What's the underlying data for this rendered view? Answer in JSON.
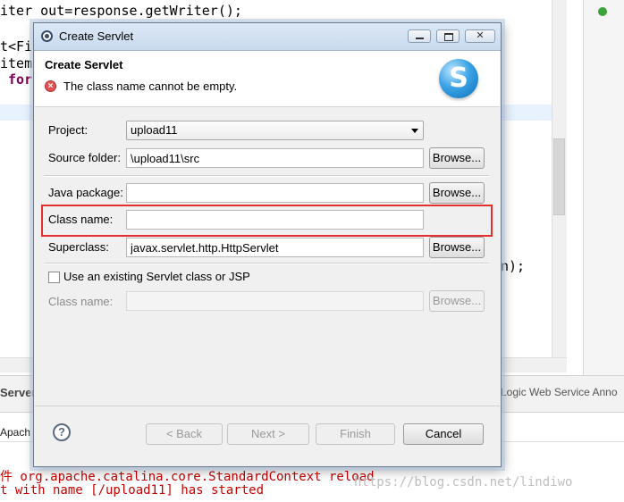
{
  "background": {
    "code_lines": [
      {
        "text": "iter out=response.getWriter();"
      },
      {
        "text": "t<Fil"
      },
      {
        "text": "items"
      },
      {
        "text": " for"
      },
      {
        "text": "n);"
      }
    ],
    "panel_tabs": {
      "left": "Server",
      "right": "Logic Web Service Anno"
    },
    "apach_label": "Apach",
    "console_lines": [
      "件 org.apache.catalina.core.StandardContext reload",
      "t with name [/upload11] has started"
    ],
    "watermark": "https://blog.csdn.net/lindiwo"
  },
  "dialog": {
    "title": "Create Servlet",
    "header": {
      "title": "Create Servlet",
      "error_message": "The class name cannot be empty."
    },
    "form": {
      "project": {
        "label": "Project:",
        "value": "upload11"
      },
      "source_folder": {
        "label": "Source folder:",
        "value": "\\upload11\\src",
        "browse": "Browse..."
      },
      "java_package": {
        "label": "Java package:",
        "value": "",
        "browse": "Browse..."
      },
      "class_name": {
        "label": "Class name:",
        "value": ""
      },
      "superclass": {
        "label": "Superclass:",
        "value": "javax.servlet.http.HttpServlet",
        "browse": "Browse..."
      },
      "use_existing": {
        "label": "Use an existing Servlet class or JSP",
        "checked": false
      },
      "existing_class_name": {
        "label": "Class name:",
        "value": "",
        "browse": "Browse..."
      }
    },
    "buttons": {
      "back": "< Back",
      "next": "Next >",
      "finish": "Finish",
      "cancel": "Cancel"
    },
    "highlight_color": "#e03030"
  }
}
